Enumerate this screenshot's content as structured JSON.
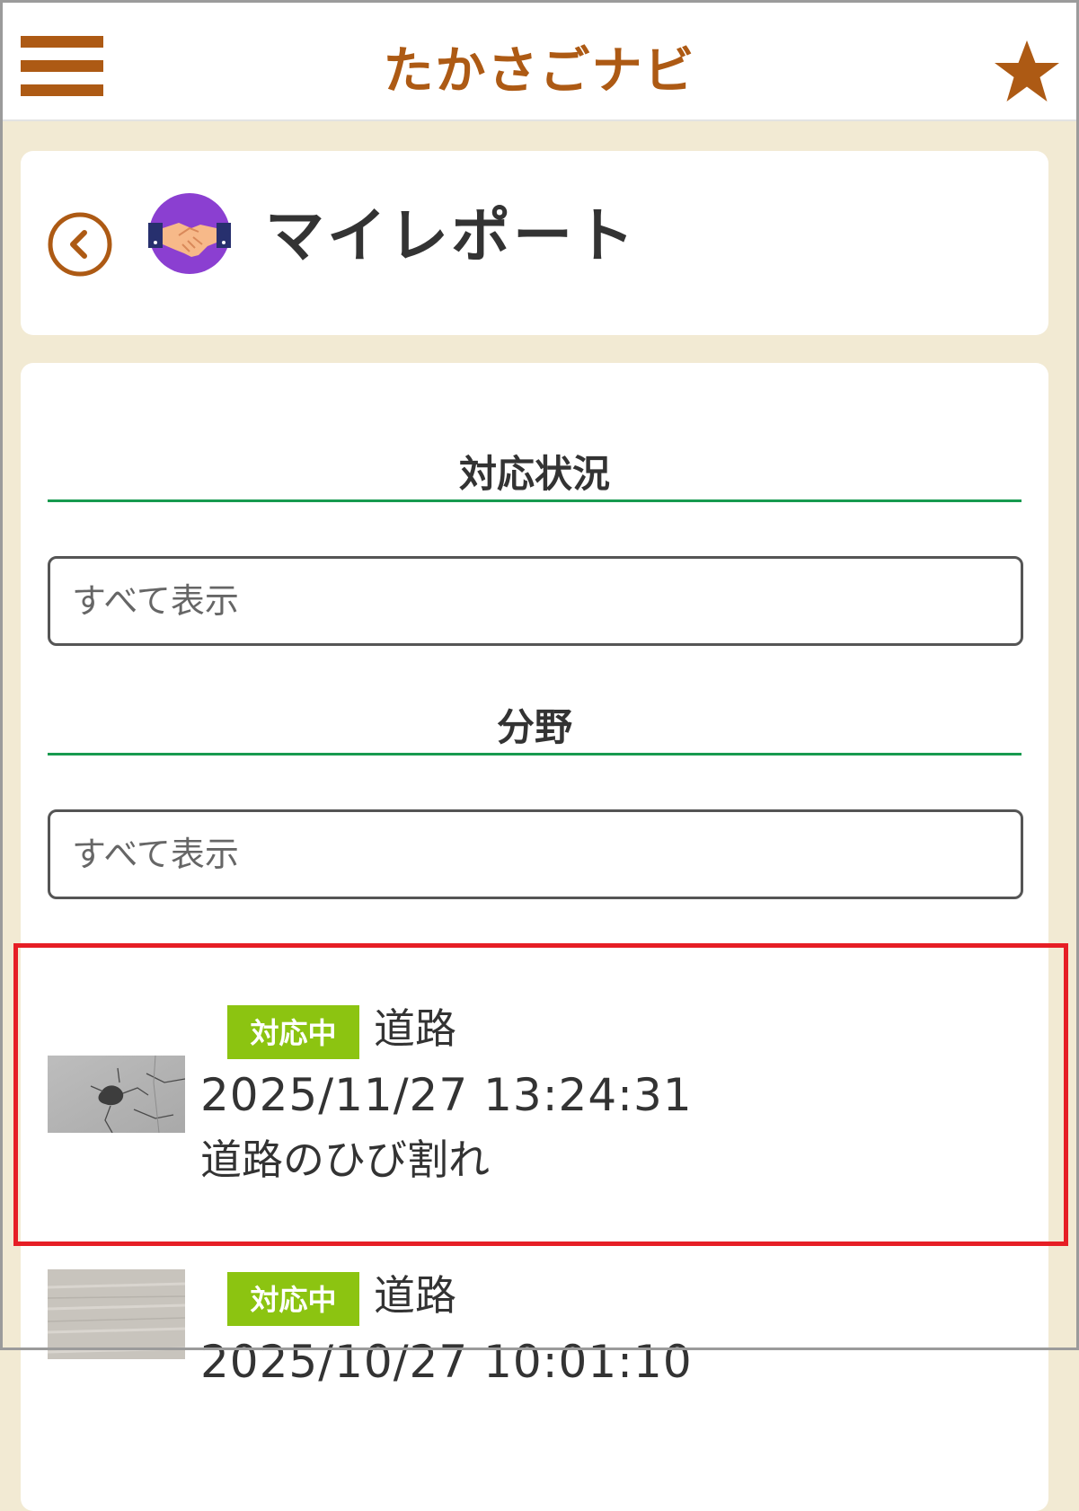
{
  "header": {
    "title": "たかさごナビ",
    "menu_icon": "hamburger-menu-icon",
    "favorite_icon": "star-icon",
    "accent_color": "#ad5a14"
  },
  "page": {
    "title": "マイレポート",
    "back_icon": "chevron-left-circle-icon",
    "category_icon": "handshake-icon",
    "category_icon_color": "#8b3fd1"
  },
  "filters": {
    "status": {
      "label": "対応状況",
      "value": "すべて表示"
    },
    "field": {
      "label": "分野",
      "value": "すべて表示"
    }
  },
  "reports": [
    {
      "status": "対応中",
      "category": "道路",
      "datetime": "2025/11/27 13:24:31",
      "description": "道路のひび割れ"
    },
    {
      "status": "対応中",
      "category": "道路",
      "datetime": "2025/10/27 10:01:10"
    }
  ],
  "colors": {
    "background": "#f2ead3",
    "badge": "#8cc411",
    "divider": "#179a4f",
    "highlight": "#e61e25"
  }
}
